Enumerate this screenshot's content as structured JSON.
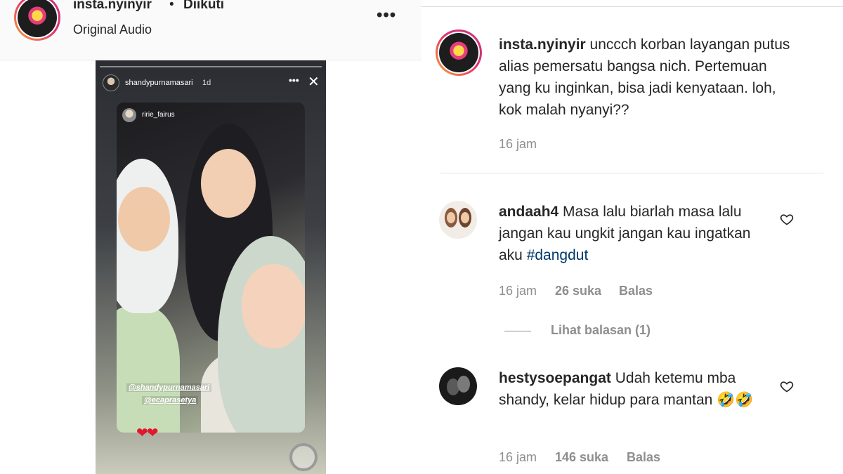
{
  "post_header": {
    "username": "insta.nyinyir",
    "separator": "•",
    "follow_status": "Diikuti",
    "audio": "Original Audio",
    "more": "•••"
  },
  "story": {
    "username": "shandypurnamasari",
    "time": "1d",
    "more": "•••",
    "close": "✕",
    "repost_username": "ririe_fairus",
    "mention_1": "@shandypurnamasari",
    "mention_2": "@ecaprasetya",
    "hearts": "❤❤"
  },
  "caption": {
    "username": "insta.nyinyir",
    "text": "unccch korban layangan putus alias pemersatu bangsa nich. Pertemuan yang ku inginkan, bisa jadi kenyataan. loh, kok malah nyanyi??",
    "time": "16 jam"
  },
  "comments": [
    {
      "username": "andaah4",
      "text": "Masa lalu biarlah masa lalu jangan kau ungkit jangan kau ingatkan aku",
      "hashtag": "#dangdut",
      "time": "16 jam",
      "likes": "26 suka",
      "reply": "Balas",
      "view_replies": "Lihat balasan (1)"
    },
    {
      "username": "hestysoepangat",
      "text": "Udah ketemu mba shandy, kelar hidup para mantan 🤣🤣",
      "time": "16 jam",
      "likes": "146 suka",
      "reply": "Balas"
    }
  ],
  "colors": {
    "text": "#262626",
    "meta": "#8e8e8e",
    "hashtag": "#00376b",
    "ring_start": "#f9a23b",
    "ring_end": "#c13584"
  }
}
